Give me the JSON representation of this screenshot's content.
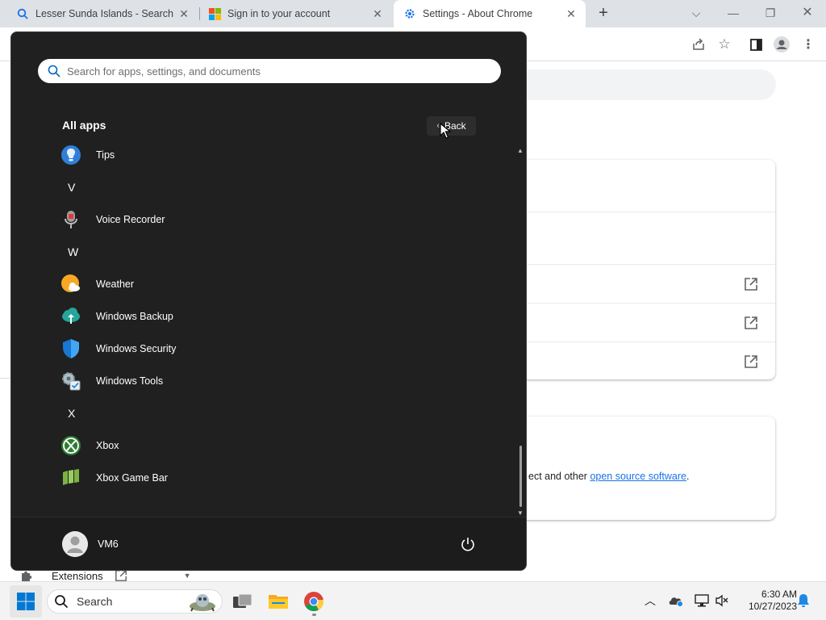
{
  "browser": {
    "tabs": [
      {
        "label": "Lesser Sunda Islands - Search",
        "icon": "search-icon",
        "active": false
      },
      {
        "label": "Sign in to your account",
        "icon": "microsoft-logo-icon",
        "active": false
      },
      {
        "label": "Settings - About Chrome",
        "icon": "gear-icon",
        "active": true
      }
    ],
    "links_text_prefix": "ect and other ",
    "open_source_link": "open source software",
    "open_source_suffix": ".",
    "extensions_label": "Extensions"
  },
  "start_menu": {
    "search_placeholder": "Search for apps, settings, and documents",
    "all_apps_title": "All apps",
    "back_label": "Back",
    "entries": [
      {
        "kind": "app",
        "label": "Tips",
        "icon": "tips-icon"
      },
      {
        "kind": "letter",
        "label": "V"
      },
      {
        "kind": "app",
        "label": "Voice Recorder",
        "icon": "voice-recorder-icon"
      },
      {
        "kind": "letter",
        "label": "W"
      },
      {
        "kind": "app",
        "label": "Weather",
        "icon": "weather-icon"
      },
      {
        "kind": "app",
        "label": "Windows Backup",
        "icon": "windows-backup-icon"
      },
      {
        "kind": "app",
        "label": "Windows Security",
        "icon": "windows-security-icon"
      },
      {
        "kind": "app",
        "label": "Windows Tools",
        "icon": "windows-tools-icon"
      },
      {
        "kind": "letter",
        "label": "X"
      },
      {
        "kind": "app",
        "label": "Xbox",
        "icon": "xbox-icon"
      },
      {
        "kind": "app",
        "label": "Xbox Game Bar",
        "icon": "xbox-game-bar-icon"
      }
    ],
    "user_name": "VM6"
  },
  "taskbar": {
    "search_label": "Search",
    "time": "6:30 AM",
    "date": "10/27/2023"
  },
  "colors": {
    "start_bg": "#202020",
    "accent": "#0067c0",
    "link": "#1a73e8"
  }
}
